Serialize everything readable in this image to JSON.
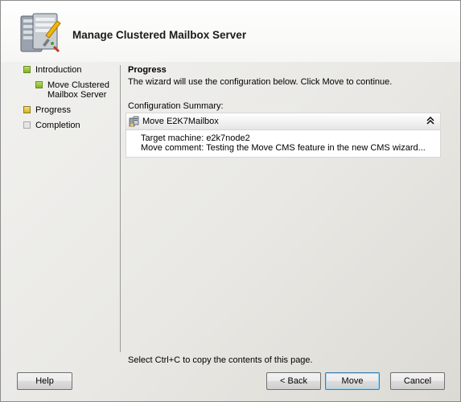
{
  "window": {
    "title": "Manage Clustered Mailbox Server"
  },
  "nav": {
    "items": [
      {
        "label": "Introduction",
        "state": "complete"
      },
      {
        "label": "Move Clustered Mailbox Server",
        "state": "complete"
      },
      {
        "label": "Progress",
        "state": "current"
      },
      {
        "label": "Completion",
        "state": "pending"
      }
    ]
  },
  "content": {
    "title": "Progress",
    "description": "The wizard will use the configuration below.  Click Move to continue.",
    "config_label": "Configuration Summary:",
    "panel": {
      "title": "Move E2K7Mailbox",
      "collapse_glyph": "˄",
      "lines": [
        "Target machine: e2k7node2",
        "Move comment: Testing the Move CMS feature in the new CMS wizard..."
      ]
    }
  },
  "footer": {
    "hint": "Select Ctrl+C to copy the contents of this page.",
    "buttons": {
      "help": "Help",
      "back": "< Back",
      "move": "Move",
      "cancel": "Cancel"
    }
  },
  "colors": {
    "complete": "#8cc63f",
    "current": "#e8c93a",
    "pending": "#e6e6e6",
    "default_button_border": "#3c7fb1"
  },
  "icons": {
    "header": "server-wizard-icon",
    "panel": "mailbox-server-icon",
    "collapse": "collapse-up-icon"
  }
}
